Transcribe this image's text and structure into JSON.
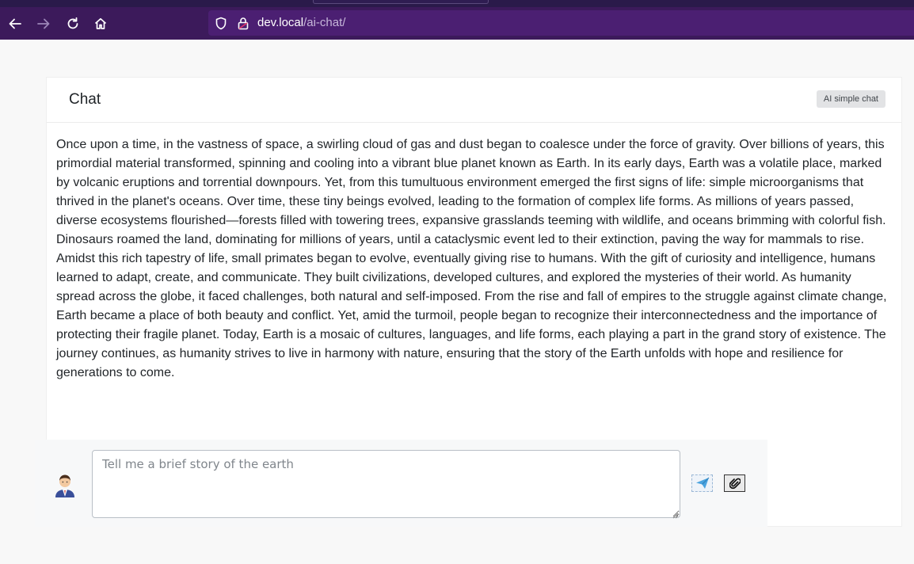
{
  "browser": {
    "url_host": "dev.local",
    "url_path": "/ai-chat/",
    "icons": [
      "back-arrow-icon",
      "forward-arrow-icon",
      "reload-icon",
      "home-icon",
      "shield-icon",
      "lock-icon"
    ]
  },
  "chat": {
    "title": "Chat",
    "badge": "AI simple chat",
    "response": "Once upon a time, in the vastness of space, a swirling cloud of gas and dust began to coalesce under the force of gravity. Over billions of years, this primordial material transformed, spinning and cooling into a vibrant blue planet known as Earth. In its early days, Earth was a volatile place, marked by volcanic eruptions and torrential downpours. Yet, from this tumultuous environment emerged the first signs of life: simple microorganisms that thrived in the planet's oceans. Over time, these tiny beings evolved, leading to the formation of complex life forms. As millions of years passed, diverse ecosystems flourished—forests filled with towering trees, expansive grasslands teeming with wildlife, and oceans brimming with colorful fish. Dinosaurs roamed the land, dominating for millions of years, until a cataclysmic event led to their extinction, paving the way for mammals to rise. Amidst this rich tapestry of life, small primates began to evolve, eventually giving rise to humans. With the gift of curiosity and intelligence, humans learned to adapt, create, and communicate. They built civilizations, developed cultures, and explored the mysteries of their world. As humanity spread across the globe, it faced challenges, both natural and self-imposed. From the rise and fall of empires to the struggle against climate change, Earth became a place of both beauty and conflict. Yet, amid the turmoil, people began to recognize their interconnectedness and the importance of protecting their fragile planet. Today, Earth is a mosaic of cultures, languages, and life forms, each playing a part in the grand story of existence. The journey continues, as humanity strives to live in harmony with nature, ensuring that the story of the Earth unfolds with hope and resilience for generations to come."
  },
  "composer": {
    "placeholder": "Tell me a brief story of the earth",
    "icons": [
      "user-avatar-icon",
      "send-icon",
      "paperclip-icon"
    ]
  },
  "colors": {
    "toolbar": "#3c1a5b",
    "urlbar": "#4b1f72",
    "send_icon": "#4aa3df"
  }
}
